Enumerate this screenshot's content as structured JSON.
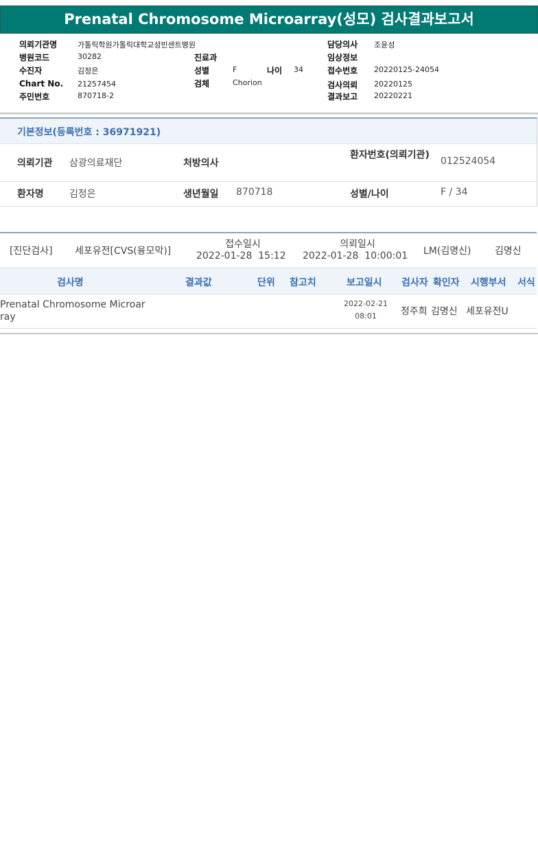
{
  "report": {
    "title": "Prenatal Chromosome Microarray(성모) 검사결과보고서",
    "left": [
      {
        "label": "의뢰기관명",
        "value": "가톨릭학원가톨릭대학교성빈센트병원"
      },
      {
        "label": "병원코드",
        "value": "30282"
      },
      {
        "label": "수진자",
        "value": "김정은"
      },
      {
        "label": "Chart No.",
        "value": "21257454"
      },
      {
        "label": "주민번호",
        "value": "870718-2"
      }
    ],
    "middle": {
      "dept_label": "진료과",
      "dept_value": "",
      "sex_label": "성별",
      "sex_value": "F",
      "age_label": "나이",
      "age_value": "34",
      "specimen_label": "검체",
      "specimen_value": "Chorion"
    },
    "right": [
      {
        "label": "담당의사",
        "value": "조윤성"
      },
      {
        "label": "임상정보",
        "value": ""
      },
      {
        "label": "접수번호",
        "value": "20220125-24054"
      },
      {
        "label": "검사의뢰",
        "value": "20220125"
      },
      {
        "label": "결과보고",
        "value": "20220221"
      }
    ]
  },
  "basic_info": {
    "title": "기본정보(등록번호 : 36971921)",
    "row1": {
      "institution_label": "의뢰기관",
      "institution_value": "삼광의료재단",
      "doctor_label": "처방의사",
      "doctor_value": "",
      "patient_no_label": "환자번호(의뢰기관)",
      "patient_no_value": "012524054"
    },
    "row2": {
      "name_label": "환자명",
      "name_value": "김정은",
      "birth_label": "생년월일",
      "birth_value": "870718",
      "sexage_label": "성별/나이",
      "sexage_value": "F / 34"
    }
  },
  "order": {
    "category": "[진단검사]",
    "test": "세포유전[CVS(융모막)]",
    "received_label": "접수일시",
    "received_value": "2022-01-28  15:12",
    "requested_label": "의뢰일시",
    "requested_value": "2022-01-28  10:00:01",
    "lab": "LM(김명신)",
    "confirmer": "김명신"
  },
  "results": {
    "headers": [
      "검사명",
      "결과값",
      "단위",
      "참고치",
      "보고일시",
      "검사자",
      "확인자",
      "시행부서",
      "서식"
    ],
    "rows": [
      {
        "test_name": "Prenatal Chromosome Microarray",
        "result": "",
        "unit": "",
        "reference": "",
        "report_date": "2022-02-21",
        "report_time": "08:01",
        "tester": "정주희",
        "confirmer": "김명신",
        "dept": "세포유전U",
        "form": ""
      }
    ]
  }
}
